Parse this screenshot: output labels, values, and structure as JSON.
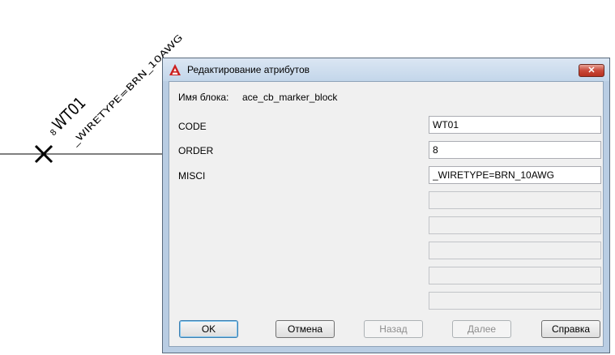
{
  "drawing": {
    "marker_prefix": "8",
    "marker_code": "WT01",
    "marker_wiretype": "_WIRETYPE=BRN_10AWG"
  },
  "dialog": {
    "title": "Редактирование атрибутов",
    "close_symbol": "✕",
    "block_name_label": "Имя блока:",
    "block_name_value": "ace_cb_marker_block",
    "attributes": [
      {
        "label": "CODE",
        "value": "WT01"
      },
      {
        "label": "ORDER",
        "value": "8"
      },
      {
        "label": "MISCI",
        "value": "_WIRETYPE=BRN_10AWG"
      }
    ],
    "empty_fields": 5,
    "buttons": {
      "ok": "OK",
      "cancel": "Отмена",
      "back": "Назад",
      "next": "Далее",
      "help": "Справка"
    }
  },
  "colors": {
    "accent_icon": "#cc1f1f",
    "close_button": "#c9493a",
    "frame": "#b9cde3"
  }
}
